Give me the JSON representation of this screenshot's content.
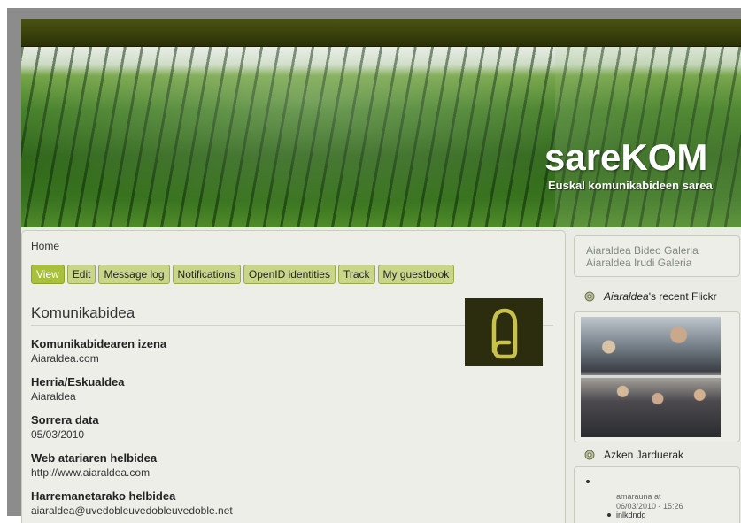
{
  "site": {
    "name": "sareKOM",
    "slogan": "Euskal komunikabideen sarea"
  },
  "breadcrumb": "Home",
  "tabs": [
    {
      "label": "View",
      "active": true
    },
    {
      "label": "Edit",
      "active": false
    },
    {
      "label": "Message log",
      "active": false
    },
    {
      "label": "Notifications",
      "active": false
    },
    {
      "label": "OpenID identities",
      "active": false
    },
    {
      "label": "Track",
      "active": false
    },
    {
      "label": "My guestbook",
      "active": false
    }
  ],
  "content": {
    "title": "Komunikabidea",
    "fields": [
      {
        "label": "Komunikabidearen izena",
        "value": "Aiaraldea.com"
      },
      {
        "label": "Herria/Eskualdea",
        "value": "Aiaraldea"
      },
      {
        "label": "Sorrera data",
        "value": "05/03/2010"
      },
      {
        "label": "Web atariaren helbidea",
        "value": "http://www.aiaraldea.com"
      },
      {
        "label": "Harremanetarako helbidea",
        "value": "aiaraldea@uvedobleuvedobleuvedoble.net"
      }
    ]
  },
  "sidebar": {
    "links": [
      "Aiaraldea Bideo Galeria",
      "Aiaraldea Irudi Galeria"
    ],
    "flickr_title_owner": "Aiaraldea",
    "flickr_title_rest": "'s recent Flickr",
    "activity_title": "Azken Jarduerak",
    "activity": {
      "user": "amarauna at",
      "date": "06/03/2010 - 15:26",
      "item": "inlkdndg"
    }
  },
  "colors": {
    "tab_bg": "#c9d68a",
    "tab_active_bg": "#a9c03a",
    "topbar": "#3a420c",
    "logo_bg": "#2c2c0e",
    "logo_mark": "#c8c24a"
  }
}
